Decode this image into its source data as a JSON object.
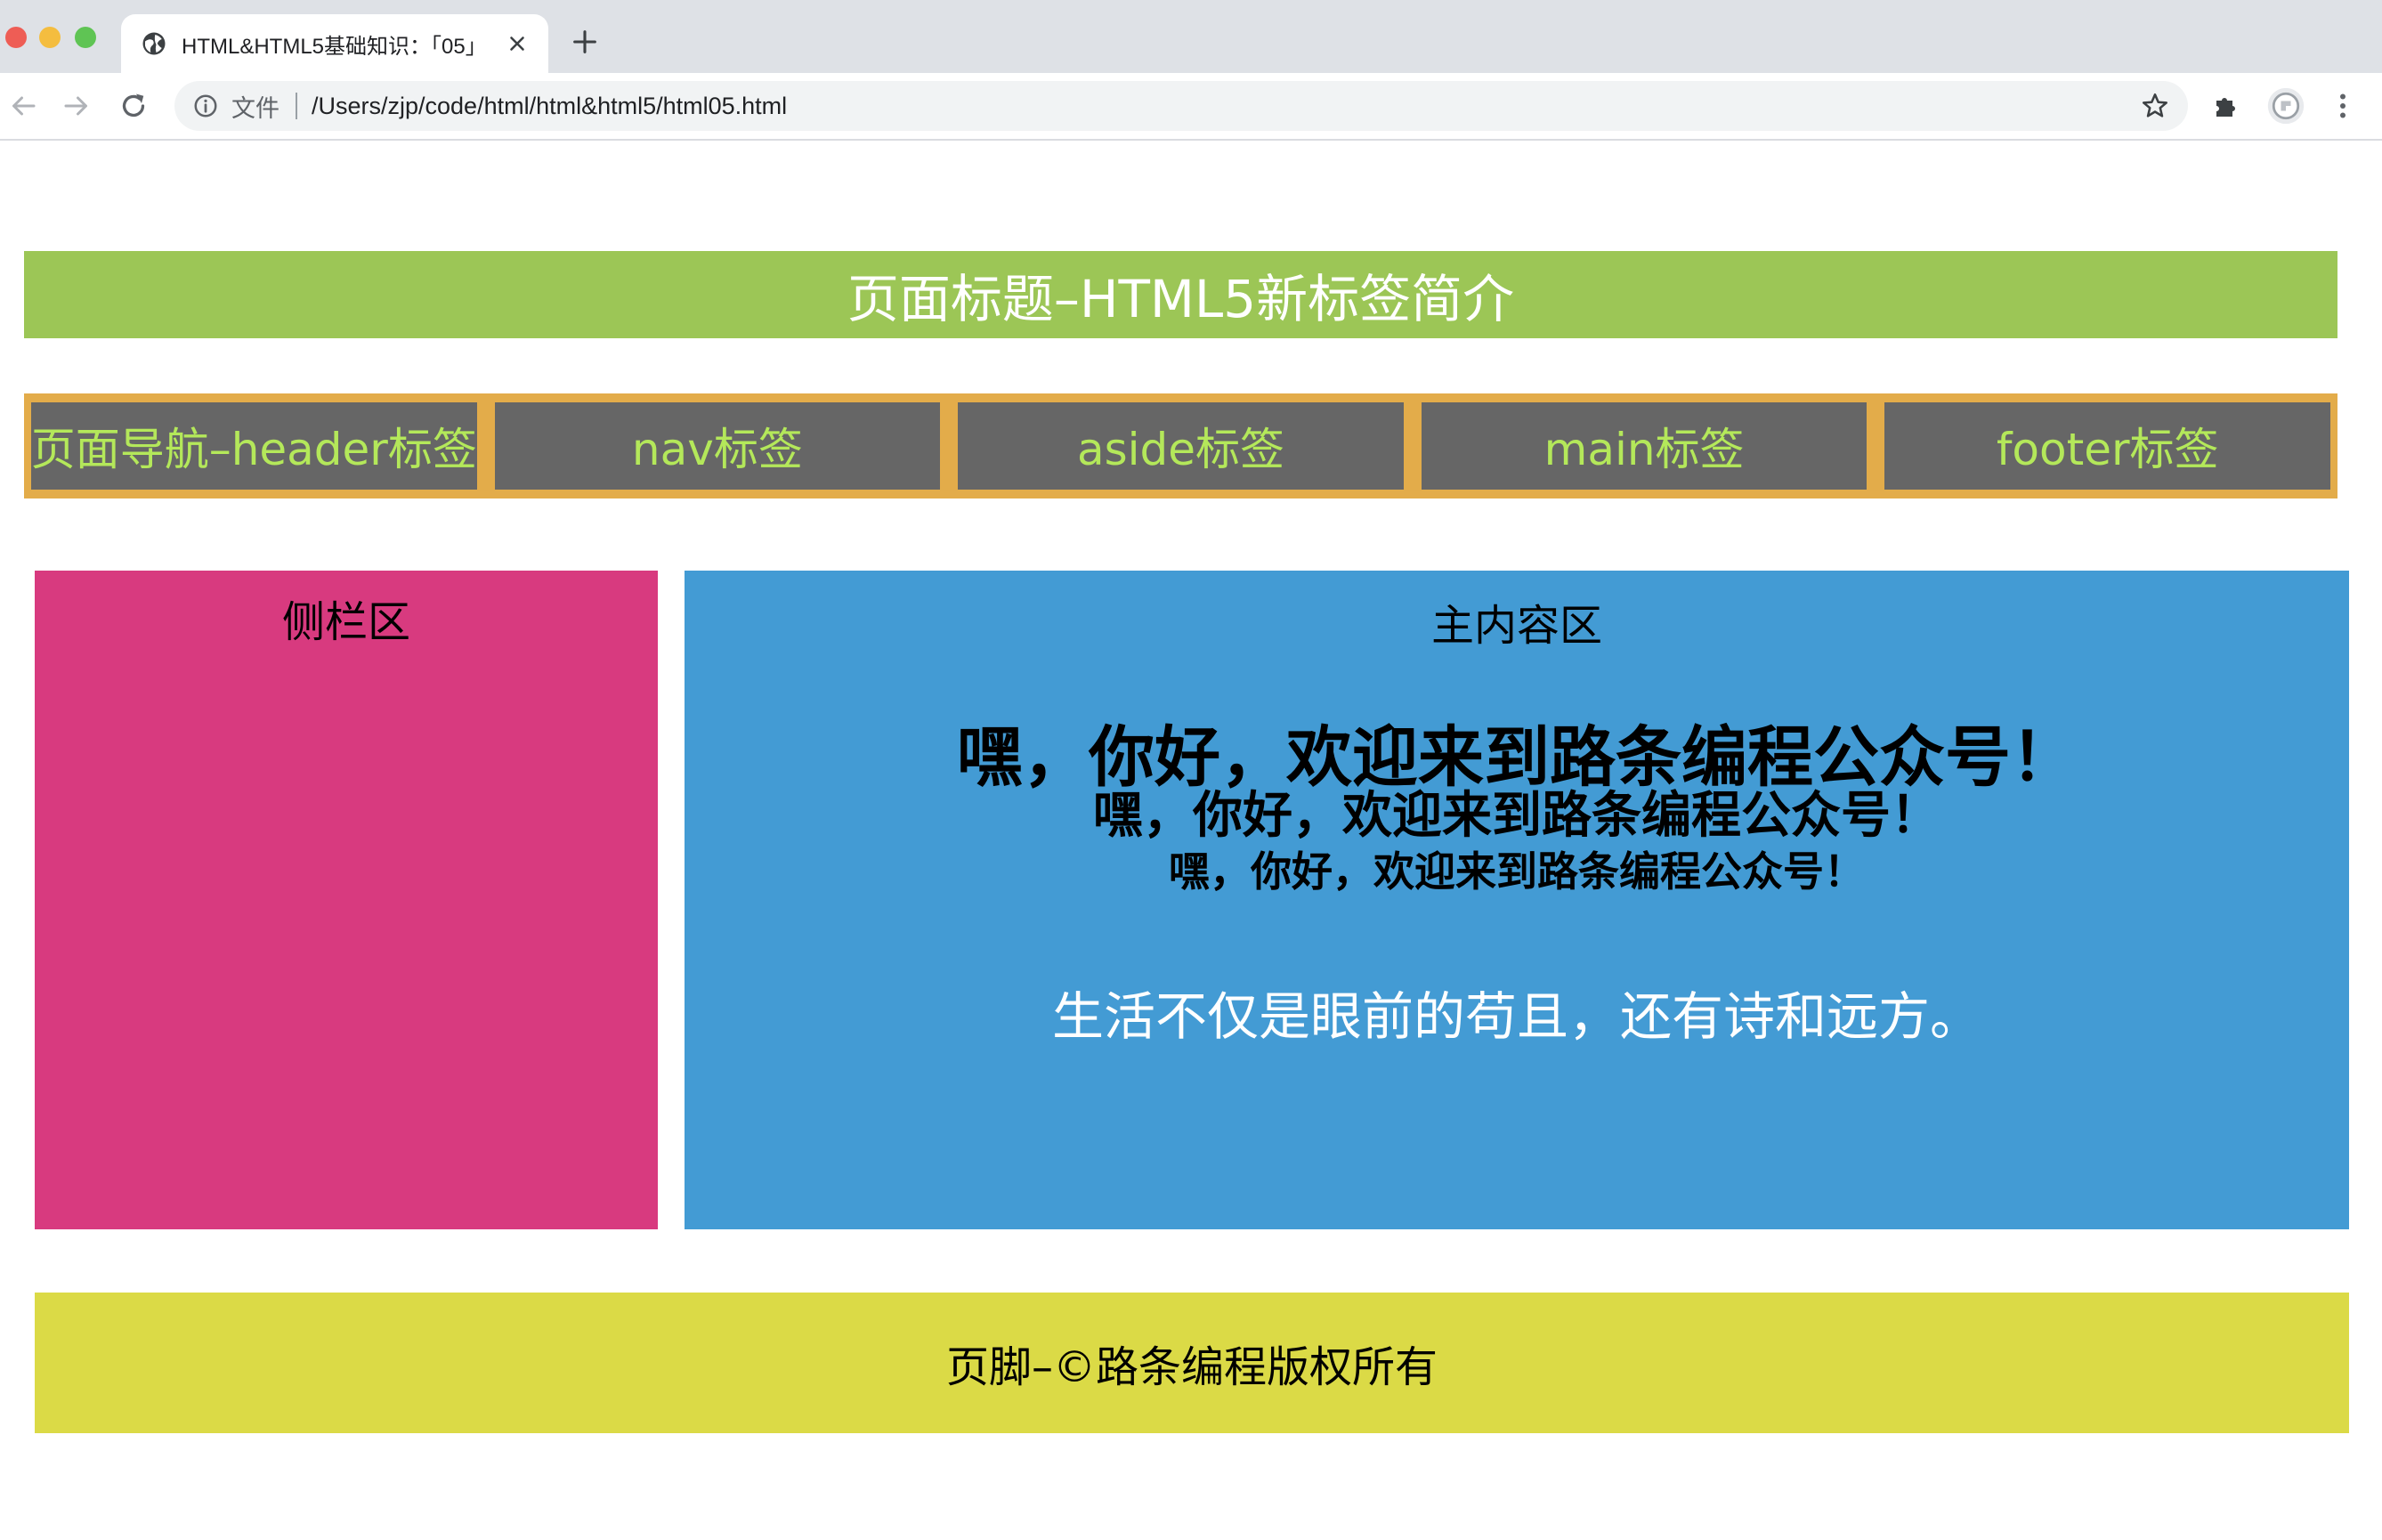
{
  "browser": {
    "tab": {
      "title": "HTML&HTML5基础知识：「05」"
    },
    "address": {
      "chip": "文件",
      "url": "/Users/zjp/code/html/html&html5/html05.html"
    }
  },
  "page": {
    "header": {
      "title": "页面标题–HTML5新标签简介"
    },
    "nav": {
      "items": [
        {
          "label": "页面导航–header标签"
        },
        {
          "label": "nav标签"
        },
        {
          "label": "aside标签"
        },
        {
          "label": "main标签"
        },
        {
          "label": "footer标签"
        }
      ]
    },
    "aside": {
      "title": "侧栏区"
    },
    "main": {
      "title": "主内容区",
      "greeting_h1": "嘿，你好，欢迎来到路条编程公众号！",
      "greeting_h2": "嘿，你好，欢迎来到路条编程公众号！",
      "greeting_h3": "嘿，你好，欢迎来到路条编程公众号！",
      "motto": "生活不仅是眼前的苟且，还有诗和远方。"
    },
    "footer": {
      "text": "页脚–©路条编程版权所有"
    }
  },
  "icons": {
    "tab_favicon": "globe-icon",
    "tab_close": "close-icon",
    "new_tab": "plus-icon",
    "back": "arrow-left-icon",
    "forward": "arrow-right-icon",
    "reload": "reload-icon",
    "site_info": "info-icon",
    "bookmark": "star-icon",
    "extensions": "puzzle-icon",
    "profile": "avatar-icon",
    "menu": "kebab-menu-icon"
  },
  "colors": {
    "header_bg": "#9cc656",
    "nav_border": "#e3ac4a",
    "nav_item_bg": "#666666",
    "nav_text": "#b4e85a",
    "aside_bg": "#d83a7f",
    "main_bg": "#439bd4",
    "footer_bg": "#dbda46"
  }
}
